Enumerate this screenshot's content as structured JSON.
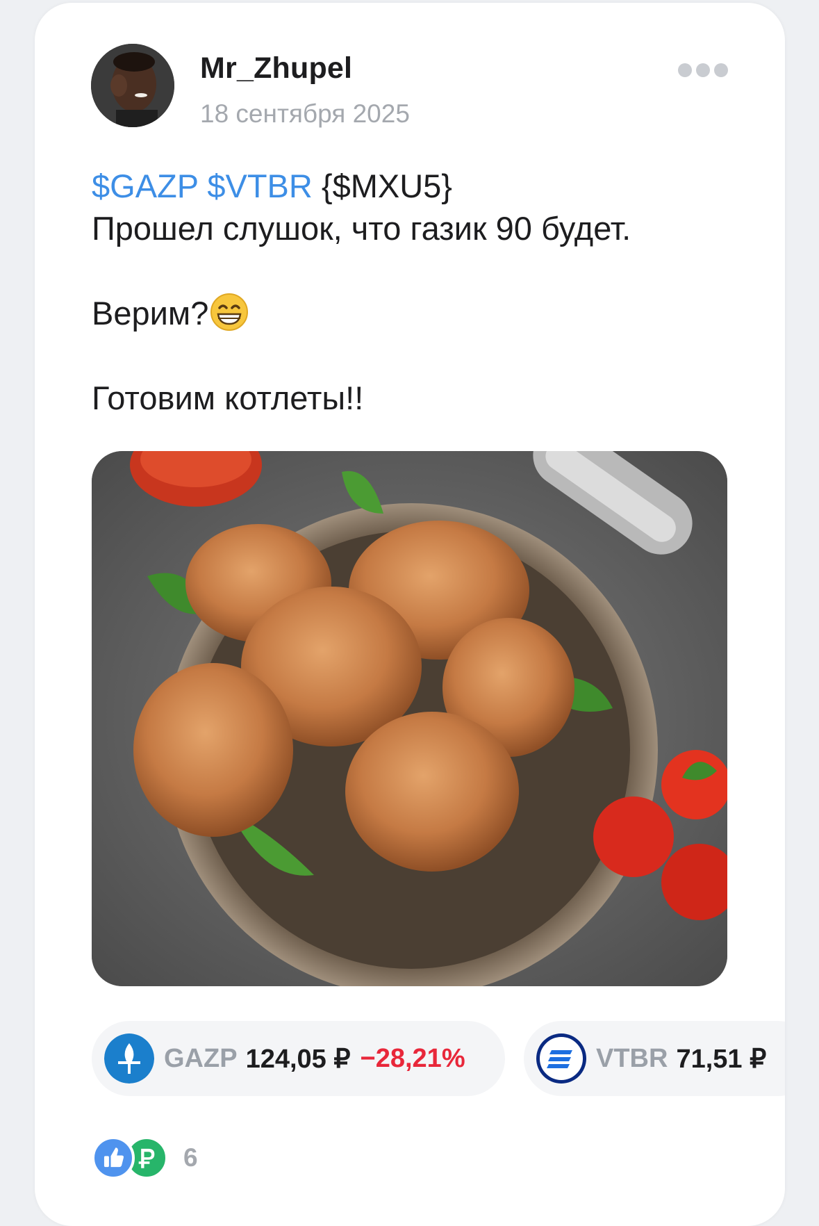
{
  "post": {
    "author": "Mr_Zhupel",
    "date": "18 сентября 2025",
    "more_icon": "more-dots-icon",
    "text": {
      "ticker_1": "$GAZP",
      "ticker_2": "$VTBR",
      "ticker_3": "{$MXU5}",
      "line_2": "Прошел слушок, что газик 90 будет.",
      "line_3": "Верим?",
      "line_3_emoji": "grinning-face-emoji",
      "line_4": "Готовим котлеты!!"
    },
    "image": "photo-cutlets-in-bowl"
  },
  "instruments": [
    {
      "ticker": "GAZP",
      "price": "124,05 ₽",
      "change": "−28,21%",
      "icon": "gazprom-logo-icon",
      "change_color": "#e8273a"
    },
    {
      "ticker": "VTBR",
      "price": "71,51 ₽",
      "icon": "vtb-logo-icon"
    }
  ],
  "reactions": {
    "icons": [
      "thumbs-up-icon",
      "ruble-icon"
    ],
    "count": "6"
  },
  "colors": {
    "link": "#3d8ee6",
    "negative": "#e8273a",
    "muted": "#a4a8ae"
  }
}
